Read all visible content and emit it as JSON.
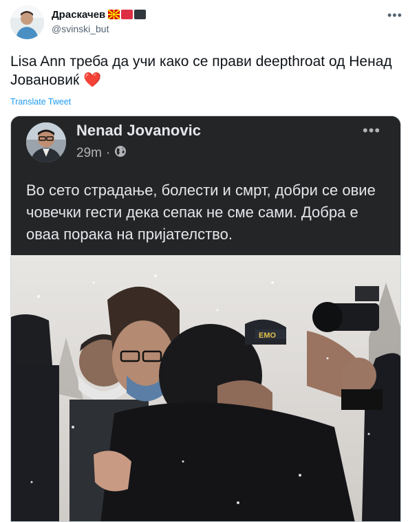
{
  "tweet": {
    "display_name": "Драскачев",
    "handle": "@svinski_but",
    "text": "Lisa Ann треба да учи како се прави deepthroat од Ненад Јовановиќ",
    "emoji": "❤️",
    "translate_label": "Translate Tweet",
    "more_label": "•••"
  },
  "embedded_post": {
    "author": "Nenad Jovanovic",
    "time": "29m",
    "separator": "·",
    "more_label": "•••",
    "text": "Во сето страдање, болести и смрт, добри се овие човечки гести дека сепак не сме сами. Добра е оваа порака на пријателство."
  },
  "colors": {
    "accent": "#1d9bf0",
    "heart": "#e0245e",
    "fb_background": "#242526"
  },
  "icons": {
    "globe": "globe-icon",
    "more": "more-icon"
  }
}
